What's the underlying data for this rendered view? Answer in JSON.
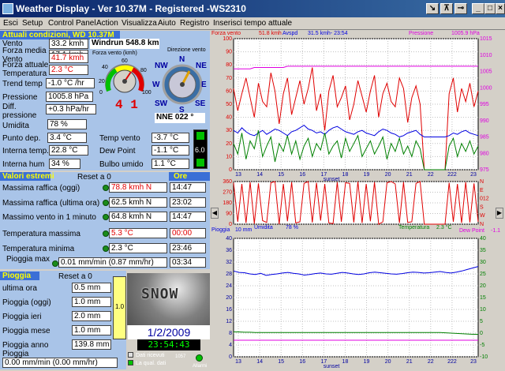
{
  "window": {
    "title": "Weather Display - Ver 10.37M - Registered  -WS2310"
  },
  "menu": [
    "Esci",
    "Setup",
    "Control Panel",
    "Action",
    "Visualizza",
    "Aiuto",
    "Registro",
    "Inserisci tempo attuale"
  ],
  "conditions": {
    "header": "Attuali condizioni, WD 10.37M",
    "rows": [
      {
        "label": "Vento",
        "value": "33.2 kmh"
      },
      {
        "label": "Forza media Vento",
        "value": "17.1 kmh"
      },
      {
        "label": "Forza attuale",
        "value": "41.7 kmh"
      },
      {
        "label": "Temperatura",
        "value": "2.3 °C"
      },
      {
        "label": "Trend temp",
        "value": "-1.0 °C /hr"
      },
      {
        "label": "Pressione",
        "value": "1005.8 hPa"
      },
      {
        "label": "Diff. pressione",
        "value": "+0.3 hPa/hr"
      },
      {
        "label": "Umidita",
        "value": "78 %"
      },
      {
        "label": "Punto dep.",
        "value": "3.4 °C"
      },
      {
        "label": "Interna temp.",
        "value": "22.8 °C"
      },
      {
        "label": "Interna hum",
        "value": "34 %"
      }
    ],
    "windrun": "Windrun 548.8 km",
    "wind_gauge_label": "Forza vento (kmh)",
    "wind_dir_label": "Direzione vento",
    "wind_gauge_digits": "4 1",
    "compass": [
      "N",
      "NE",
      "E",
      "SE",
      "S",
      "SW",
      "W",
      "NW"
    ],
    "wind_dir_value": "NNE  022 °",
    "right_rows": [
      {
        "label": "Temp vento",
        "value": "-3.7 °C"
      },
      {
        "label": "Dew Point",
        "value": "-1.1 °C"
      },
      {
        "label": "Bulbo umido",
        "value": "1.1 °C"
      }
    ],
    "thermo_value": "6.0",
    "gauge_ticks": [
      "0",
      "20",
      "40",
      "60",
      "80",
      "100"
    ]
  },
  "extremes": {
    "header": "Valori estremi",
    "reset": "Reset a 0",
    "time_header": "Ore",
    "rows": [
      {
        "label": "Massima raffica (oggi)",
        "value": "78.8 kmh  N",
        "time": "14:47",
        "red": true
      },
      {
        "label": "Massima raffica (ultima ora)",
        "value": "62.5 kmh  N",
        "time": "23:02",
        "red": false
      },
      {
        "label": "Massimo vento in 1 minuto",
        "value": "64.8 kmh  N",
        "time": "14:47",
        "red": false
      },
      {
        "label": "Temperatura massima",
        "value": "5.3 °C",
        "time": "00:00",
        "red": true
      },
      {
        "label": "Temperatura minima",
        "value": "2.3 °C",
        "time": "23:46",
        "red": false
      }
    ],
    "rain_max_label": "Pioggia max",
    "rain_max_value": "0.01 mm/min (0.87 mm/hr)",
    "rain_max_time": "03:34"
  },
  "rain": {
    "header": "Pioggia",
    "reset": "Reset a 0",
    "rows": [
      {
        "label": "ultima ora",
        "value": "0.5 mm"
      },
      {
        "label": "Pioggia (oggi)",
        "value": "1.0 mm"
      },
      {
        "label": "Pioggia ieri",
        "value": "2.0 mm"
      },
      {
        "label": "Pioggia mese",
        "value": "1.0 mm"
      },
      {
        "label": "Pioggia anno",
        "value": "139.8 mm"
      }
    ],
    "rate_label": "Pioggia",
    "rate_value": "0.00 mm/min (0.00 mm/hr)",
    "gauge_value": "1.0",
    "snow_label": "SNOW",
    "date": "1/2/2009",
    "time": "23:54:43",
    "dati_ricevuti": "Dati ricevuti",
    "qual_dati": "La qual. dati",
    "count": "1057",
    "allarmi": "Allarmi"
  },
  "chart_data": [
    {
      "type": "line",
      "title": "",
      "legend": [
        "Forza vento",
        "51.8 kmh",
        "Avspd",
        "31.5 kmh- 23:54",
        "Pressione",
        "1005.9 hPa"
      ],
      "x_ticks": [
        "13",
        "14",
        "15",
        "16",
        "17",
        "18",
        "19",
        "20",
        "21",
        "22",
        "222",
        "23"
      ],
      "x_annotation": "sunset",
      "ylim": [
        0,
        100
      ],
      "y_ticks": [
        "0",
        "10",
        "20",
        "30",
        "40",
        "50",
        "60",
        "70",
        "80",
        "90",
        "100"
      ],
      "y2lim": [
        975,
        1015
      ],
      "y2_ticks": [
        "975",
        "980",
        "985",
        "990",
        "995",
        "1000",
        "1005",
        "1010",
        "1015"
      ],
      "series": [
        {
          "name": "Forza vento",
          "color": "#e00000",
          "values": [
            62,
            45,
            58,
            70,
            55,
            40,
            66,
            52,
            48,
            74,
            60,
            35,
            58,
            70,
            42,
            55,
            68,
            50,
            62,
            78,
            45,
            58,
            30,
            60,
            72,
            48,
            55,
            64,
            38,
            50,
            68,
            56,
            44,
            60,
            72,
            40,
            58,
            66,
            52,
            48,
            70,
            62,
            36,
            55,
            64,
            50,
            0,
            0,
            0,
            0,
            0,
            0,
            58,
            70,
            44,
            62,
            52,
            66,
            48,
            60
          ]
        },
        {
          "name": "Avspd",
          "color": "#0000e0",
          "values": [
            30,
            28,
            32,
            29,
            27,
            26,
            28,
            30,
            27,
            29,
            31,
            30,
            28,
            26,
            29,
            30,
            32,
            34,
            31,
            30,
            28,
            29,
            27,
            30,
            32,
            33,
            31,
            29,
            28,
            27,
            29,
            30,
            28,
            27,
            26,
            29,
            31,
            30,
            28,
            27,
            25,
            26,
            28,
            29,
            30,
            27,
            25,
            25,
            25,
            25,
            25,
            25,
            26,
            28,
            27,
            29,
            30,
            28,
            27,
            26
          ]
        },
        {
          "name": "Raffica",
          "color": "#008000",
          "values": [
            20,
            12,
            28,
            8,
            22,
            16,
            30,
            10,
            18,
            25,
            6,
            20,
            14,
            26,
            12,
            22,
            8,
            18,
            24,
            10,
            20,
            15,
            28,
            12,
            18,
            22,
            9,
            24,
            14,
            20,
            26,
            10,
            16,
            22,
            12,
            18,
            25,
            8,
            20,
            14,
            24,
            12,
            18,
            10,
            22,
            16,
            0,
            0,
            0,
            0,
            0,
            0,
            18,
            24,
            10,
            20,
            14,
            22,
            12,
            18
          ]
        },
        {
          "name": "Pressione",
          "color": "#e000e0",
          "values": [
            77,
            77,
            77,
            77,
            77,
            78,
            78,
            78,
            78,
            78,
            78,
            78,
            78,
            79,
            79,
            79,
            79,
            79,
            79,
            79,
            79,
            79,
            79,
            79,
            79,
            79,
            79,
            79,
            79,
            79,
            79,
            79,
            79,
            79,
            79,
            79,
            79,
            79,
            79,
            79,
            79,
            79,
            79,
            79,
            79,
            79,
            79,
            79,
            79,
            79,
            79,
            79,
            79,
            79,
            79,
            79,
            79,
            79,
            79,
            79
          ]
        }
      ]
    },
    {
      "type": "line",
      "title": "",
      "ylim": [
        0,
        360
      ],
      "y_ticks": [
        "0",
        "90",
        "180",
        "270",
        "360"
      ],
      "y2_ticks": [
        "N",
        "W",
        "S",
        "012",
        "E",
        "N"
      ],
      "series": [
        {
          "name": "Direzione",
          "color": "#e00000",
          "values": [
            350,
            20,
            340,
            10,
            355,
            5,
            345,
            30,
            15,
            350,
            360,
            0,
            340,
            25,
            355,
            10,
            20,
            345,
            360,
            15,
            350,
            30,
            340,
            10,
            5,
            355,
            20,
            350,
            345,
            15,
            360,
            10,
            340,
            25,
            355,
            0,
            20,
            350,
            360,
            340,
            10,
            355,
            15,
            20,
            345,
            360,
            0,
            0,
            0,
            0,
            0,
            0,
            350,
            20,
            340,
            10,
            355,
            15,
            345,
            20
          ]
        }
      ]
    },
    {
      "type": "line",
      "title": "",
      "legend": [
        "Pioggia",
        "10 mm",
        "Umidita",
        "78 %",
        "Temperatura",
        "2.3 °C",
        "Dew Point",
        "-1.1"
      ],
      "x_ticks": [
        "13",
        "14",
        "15",
        "16",
        "17",
        "18",
        "19",
        "20",
        "21",
        "22",
        "222",
        "23"
      ],
      "x_annotation": "sunset",
      "ylim": [
        0,
        40
      ],
      "y_ticks": [
        "0",
        "4",
        "8",
        "12",
        "16",
        "20",
        "24",
        "28",
        "32",
        "36",
        "40"
      ],
      "y2lim": [
        -10,
        40
      ],
      "y2_ticks": [
        "-10",
        "-5",
        "0",
        "5",
        "10",
        "15",
        "20",
        "25",
        "30",
        "35",
        "40"
      ],
      "series": [
        {
          "name": "Umidita",
          "color": "#0000e0",
          "values": [
            29,
            28.5,
            28.4,
            28,
            27.8,
            28.2,
            27.5,
            27.8,
            28,
            28.3,
            28.5,
            28.2,
            28,
            27.6,
            27.8,
            28.1,
            28.3,
            28,
            27.9,
            28.2,
            28.5,
            28.3,
            28,
            27.8,
            28,
            28.4,
            28.6,
            28.4,
            28.2,
            28,
            27.9,
            28.1,
            28.4,
            28.6,
            28.5,
            28.3,
            28.4,
            28.6,
            28.8,
            28.5,
            28.3,
            28.6,
            29,
            29.5,
            30,
            30.5
          ]
        },
        {
          "name": "Temperatura",
          "color": "#008000",
          "values": [
            8.4,
            8.4,
            8.3,
            8.3,
            8.2,
            8.2,
            8.2,
            8.2,
            8.2,
            8.2,
            8.2,
            8.2,
            8.2,
            8.2,
            8.2,
            8.2,
            8.2,
            8.2,
            8.2,
            8.2,
            8.2,
            8.2,
            8.2,
            8.2,
            8.2,
            8.2,
            8.2,
            8.2,
            8.2,
            8.2,
            8.2,
            8.2,
            8.2,
            8.2,
            8.2,
            8.2,
            8.2,
            8.2,
            8.2,
            8.1,
            8.0,
            7.9,
            7.8,
            7.7,
            7.6,
            7.6
          ]
        },
        {
          "name": "Dew Point",
          "color": "#e000e0",
          "values": [
            5.6,
            5.6,
            5.6,
            5.6,
            5.6,
            5.6,
            5.6,
            5.6,
            5.6,
            5.6,
            5.6,
            5.6,
            5.6,
            5.6,
            5.6,
            5.6,
            5.6,
            5.6,
            5.6,
            5.6,
            5.6,
            5.6,
            5.6,
            5.6,
            5.6,
            5.6,
            5.6,
            5.6,
            5.6,
            5.6,
            5.6,
            5.6,
            5.6,
            5.6,
            5.6,
            5.6,
            5.6,
            5.6,
            5.6,
            5.6,
            5.6,
            5.6,
            5.6,
            5.6,
            5.6,
            5.6
          ]
        }
      ]
    }
  ]
}
